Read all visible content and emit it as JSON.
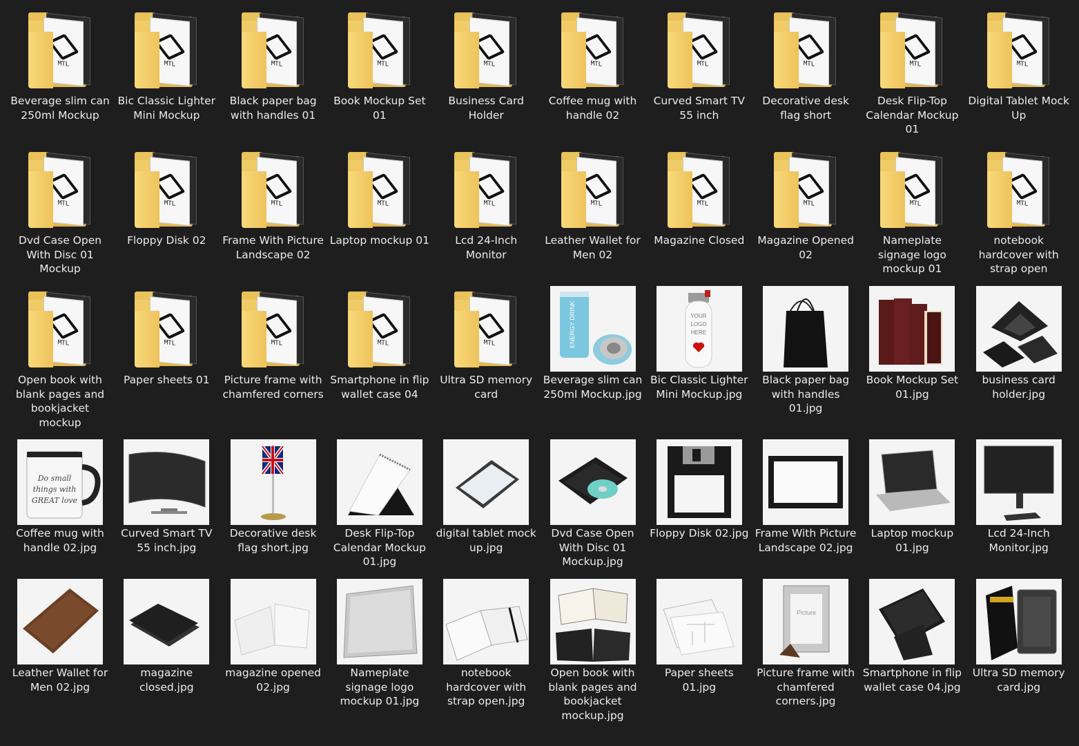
{
  "items": [
    {
      "label": "Beverage slim can 250ml Mockup",
      "kind": "folder",
      "icon": "folder-icon"
    },
    {
      "label": "Bic Classic Lighter Mini Mockup",
      "kind": "folder",
      "icon": "folder-icon"
    },
    {
      "label": "Black paper bag with handles 01",
      "kind": "folder",
      "icon": "folder-icon"
    },
    {
      "label": "Book Mockup Set 01",
      "kind": "folder",
      "icon": "folder-icon"
    },
    {
      "label": "Business Card Holder",
      "kind": "folder",
      "icon": "folder-icon"
    },
    {
      "label": "Coffee mug with handle 02",
      "kind": "folder",
      "icon": "folder-icon"
    },
    {
      "label": "Curved Smart TV 55 inch",
      "kind": "folder",
      "icon": "folder-icon"
    },
    {
      "label": "Decorative desk flag short",
      "kind": "folder",
      "icon": "folder-icon"
    },
    {
      "label": "Desk Flip-Top Calendar Mockup 01",
      "kind": "folder",
      "icon": "folder-icon"
    },
    {
      "label": "Digital Tablet Mock Up",
      "kind": "folder",
      "icon": "folder-icon"
    },
    {
      "label": "Dvd Case Open With Disc 01 Mockup",
      "kind": "folder",
      "icon": "folder-icon"
    },
    {
      "label": "Floppy Disk 02",
      "kind": "folder",
      "icon": "folder-icon"
    },
    {
      "label": "Frame With Picture Landscape 02",
      "kind": "folder",
      "icon": "folder-icon"
    },
    {
      "label": "Laptop mockup 01",
      "kind": "folder",
      "icon": "folder-icon"
    },
    {
      "label": "Lcd 24-Inch Monitor",
      "kind": "folder",
      "icon": "folder-icon"
    },
    {
      "label": "Leather Wallet for Men 02",
      "kind": "folder",
      "icon": "folder-icon"
    },
    {
      "label": "Magazine Closed",
      "kind": "folder",
      "icon": "folder-icon"
    },
    {
      "label": "Magazine Opened 02",
      "kind": "folder",
      "icon": "folder-icon"
    },
    {
      "label": "Nameplate signage logo mockup 01",
      "kind": "folder",
      "icon": "folder-icon"
    },
    {
      "label": "notebook hardcover with strap open",
      "kind": "folder",
      "icon": "folder-icon"
    },
    {
      "label": "Open book with blank pages and bookjacket mockup",
      "kind": "folder",
      "icon": "folder-icon"
    },
    {
      "label": "Paper sheets 01",
      "kind": "folder",
      "icon": "folder-icon"
    },
    {
      "label": "Picture frame with chamfered corners",
      "kind": "folder",
      "icon": "folder-icon"
    },
    {
      "label": "Smartphone in flip wallet case 04",
      "kind": "folder",
      "icon": "folder-icon"
    },
    {
      "label": "Ultra SD memory card",
      "kind": "folder",
      "icon": "folder-icon"
    },
    {
      "label": "Beverage slim can 250ml Mockup.jpg",
      "kind": "image",
      "icon": "can-thumbnail-icon",
      "art": "can"
    },
    {
      "label": "Bic Classic Lighter Mini Mockup.jpg",
      "kind": "image",
      "icon": "lighter-thumbnail-icon",
      "art": "lighter"
    },
    {
      "label": "Black paper bag with handles 01.jpg",
      "kind": "image",
      "icon": "bag-thumbnail-icon",
      "art": "bag"
    },
    {
      "label": "Book Mockup Set 01.jpg",
      "kind": "image",
      "icon": "books-thumbnail-icon",
      "art": "books"
    },
    {
      "label": "business card holder.jpg",
      "kind": "image",
      "icon": "card-holder-thumbnail-icon",
      "art": "cardholder"
    },
    {
      "label": "Coffee mug with handle 02.jpg",
      "kind": "image",
      "icon": "mug-thumbnail-icon",
      "art": "mug"
    },
    {
      "label": "Curved Smart TV 55 inch.jpg",
      "kind": "image",
      "icon": "tv-thumbnail-icon",
      "art": "tv"
    },
    {
      "label": "Decorative desk flag short.jpg",
      "kind": "image",
      "icon": "flag-thumbnail-icon",
      "art": "flag"
    },
    {
      "label": "Desk Flip-Top Calendar Mockup 01.jpg",
      "kind": "image",
      "icon": "calendar-thumbnail-icon",
      "art": "calendar"
    },
    {
      "label": "digital tablet mock up.jpg",
      "kind": "image",
      "icon": "tablet-thumbnail-icon",
      "art": "tablet"
    },
    {
      "label": "Dvd Case Open With Disc 01 Mockup.jpg",
      "kind": "image",
      "icon": "dvd-thumbnail-icon",
      "art": "dvd"
    },
    {
      "label": "Floppy Disk 02.jpg",
      "kind": "image",
      "icon": "floppy-thumbnail-icon",
      "art": "floppy"
    },
    {
      "label": "Frame With Picture Landscape 02.jpg",
      "kind": "image",
      "icon": "frame-thumbnail-icon",
      "art": "frame"
    },
    {
      "label": "Laptop mockup 01.jpg",
      "kind": "image",
      "icon": "laptop-thumbnail-icon",
      "art": "laptop"
    },
    {
      "label": "Lcd 24-Inch Monitor.jpg",
      "kind": "image",
      "icon": "monitor-thumbnail-icon",
      "art": "monitor"
    },
    {
      "label": "Leather Wallet for Men 02.jpg",
      "kind": "image",
      "icon": "wallet-thumbnail-icon",
      "art": "wallet"
    },
    {
      "label": "magazine closed.jpg",
      "kind": "image",
      "icon": "magazine-closed-thumbnail-icon",
      "art": "magclosed"
    },
    {
      "label": "magazine opened 02.jpg",
      "kind": "image",
      "icon": "magazine-open-thumbnail-icon",
      "art": "magopen"
    },
    {
      "label": "Nameplate signage logo mockup 01.jpg",
      "kind": "image",
      "icon": "nameplate-thumbnail-icon",
      "art": "nameplate"
    },
    {
      "label": "notebook hardcover with strap open.jpg",
      "kind": "image",
      "icon": "notebook-thumbnail-icon",
      "art": "notebook"
    },
    {
      "label": "Open book with blank pages and bookjacket mockup.jpg",
      "kind": "image",
      "icon": "open-book-thumbnail-icon",
      "art": "openbook"
    },
    {
      "label": "Paper sheets 01.jpg",
      "kind": "image",
      "icon": "paper-sheets-thumbnail-icon",
      "art": "papers"
    },
    {
      "label": "Picture frame with chamfered corners.jpg",
      "kind": "image",
      "icon": "picture-frame-thumbnail-icon",
      "art": "pframe"
    },
    {
      "label": "Smartphone in flip wallet case 04.jpg",
      "kind": "image",
      "icon": "smartphone-thumbnail-icon",
      "art": "phone"
    },
    {
      "label": "Ultra SD memory card.jpg",
      "kind": "image",
      "icon": "sd-card-thumbnail-icon",
      "art": "sd"
    }
  ],
  "folder_paper_text": "MTL",
  "can_text": "ENERGY DRINK",
  "lighter_text": "YOUR LOGO HERE",
  "mug_text": "Do small things with GREAT love",
  "frame_text": "Picture"
}
